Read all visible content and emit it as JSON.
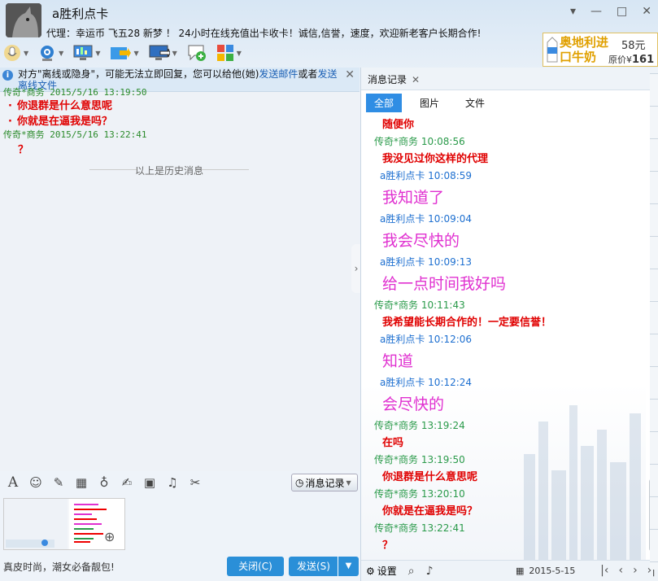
{
  "header": {
    "title": "a胜利点卡",
    "signature": "代理：幸运币   飞五28    新梦  ！ 24小时在线充值出卡收卡！诚信,信誉，速度，欢迎新老客户长期合作!",
    "win_controls": [
      "▾",
      "—",
      "□",
      "✕"
    ]
  },
  "ad": {
    "name": "奥地利进口牛奶",
    "price": "58元",
    "orig_label": "原价¥",
    "orig_value": "161"
  },
  "notice": {
    "text_before": "对方\"离线或隐身\"，可能无法立即回复，您可以给他(她)",
    "link1": "发送邮件",
    "middle": "或者",
    "link2": "发送离线文件"
  },
  "history": {
    "top_partial": "传奇*商务  2015/5/16  13:19:50",
    "items": [
      {
        "type": "msg",
        "text": "你退群是什么意思呢"
      },
      {
        "type": "msg",
        "text": "你就是在逼我是吗？"
      },
      {
        "type": "sender",
        "text": "传奇*商务  2015/5/16  13:22:41"
      },
      {
        "type": "q",
        "text": "？"
      }
    ],
    "divider": "以上是历史消息"
  },
  "input": {
    "msg_record_label": "消息记录",
    "slogan": "真皮时尚，潮女必备靓包!",
    "close_label": "关闭(C)",
    "send_label": "发送(S)"
  },
  "right": {
    "tab_label": "消息记录",
    "filters": [
      "全部",
      "图片",
      "文件"
    ],
    "messages": [
      {
        "kind": "text",
        "text": "随便你"
      },
      {
        "kind": "other",
        "text": "传奇*商务  10:08:56"
      },
      {
        "kind": "text",
        "text": "我没见过你这样的代理"
      },
      {
        "kind": "me",
        "text": "a胜利点卡  10:08:59"
      },
      {
        "kind": "big",
        "text": "我知道了"
      },
      {
        "kind": "me",
        "text": "a胜利点卡  10:09:04"
      },
      {
        "kind": "big",
        "text": "我会尽快的"
      },
      {
        "kind": "me",
        "text": "a胜利点卡  10:09:13"
      },
      {
        "kind": "big",
        "text": "给一点时间我好吗"
      },
      {
        "kind": "other",
        "text": "传奇*商务  10:11:43"
      },
      {
        "kind": "text",
        "text": "我希望能长期合作的！一定要信誉！"
      },
      {
        "kind": "me",
        "text": "a胜利点卡  10:12:06"
      },
      {
        "kind": "big",
        "text": "知道"
      },
      {
        "kind": "me",
        "text": "a胜利点卡  10:12:24"
      },
      {
        "kind": "big",
        "text": "会尽快的"
      },
      {
        "kind": "other",
        "text": "传奇*商务  13:19:24"
      },
      {
        "kind": "text",
        "text": "在吗"
      },
      {
        "kind": "other",
        "text": "传奇*商务  13:19:50"
      },
      {
        "kind": "text",
        "text": "你退群是什么意思呢"
      },
      {
        "kind": "other",
        "text": "传奇*商务  13:20:10"
      },
      {
        "kind": "text",
        "text": "你就是在逼我是吗？"
      },
      {
        "kind": "other",
        "text": "传奇*商务  13:22:41"
      },
      {
        "kind": "text",
        "text": "？"
      }
    ],
    "settings_label": "设置",
    "date": "2015-5-15"
  },
  "colors": {
    "accent": "#2f8de4",
    "other_sender": "#2a9a4a",
    "self_sender": "#1d6fd0",
    "msg_red": "#e00000",
    "msg_pink": "#e030d0"
  },
  "icons": [
    "mic-icon",
    "camera-icon",
    "screen-share-icon",
    "file-transfer-icon",
    "remote-icon",
    "add-chat-icon",
    "apps-icon",
    "font-icon",
    "emoji-icon",
    "magic-icon",
    "video-icon",
    "voice-icon",
    "edit-icon",
    "image-icon",
    "music-icon",
    "scissors-icon",
    "zoom-icon",
    "gear-icon",
    "search-icon",
    "speaker-icon",
    "calendar-icon"
  ]
}
